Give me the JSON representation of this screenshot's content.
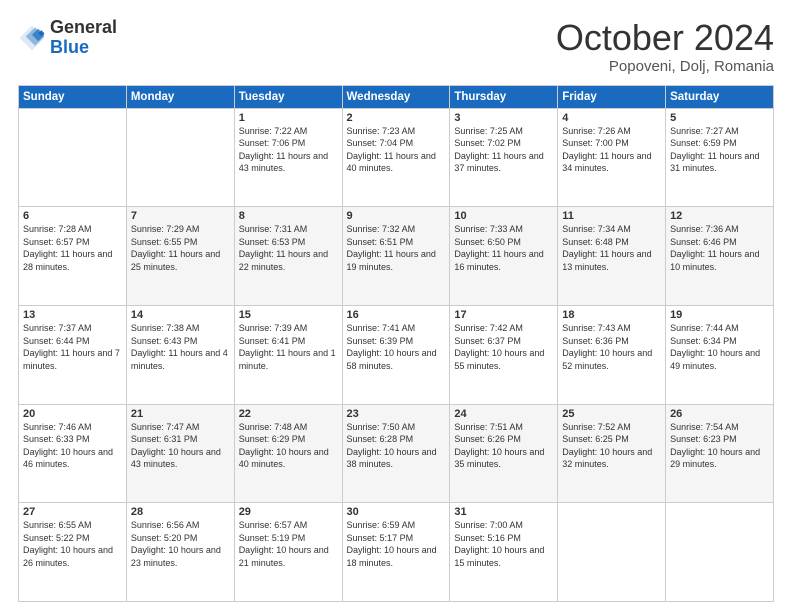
{
  "header": {
    "logo_general": "General",
    "logo_blue": "Blue",
    "month_title": "October 2024",
    "location": "Popoveni, Dolj, Romania"
  },
  "days_of_week": [
    "Sunday",
    "Monday",
    "Tuesday",
    "Wednesday",
    "Thursday",
    "Friday",
    "Saturday"
  ],
  "weeks": [
    [
      {
        "day": "",
        "info": ""
      },
      {
        "day": "",
        "info": ""
      },
      {
        "day": "1",
        "info": "Sunrise: 7:22 AM\nSunset: 7:06 PM\nDaylight: 11 hours and 43 minutes."
      },
      {
        "day": "2",
        "info": "Sunrise: 7:23 AM\nSunset: 7:04 PM\nDaylight: 11 hours and 40 minutes."
      },
      {
        "day": "3",
        "info": "Sunrise: 7:25 AM\nSunset: 7:02 PM\nDaylight: 11 hours and 37 minutes."
      },
      {
        "day": "4",
        "info": "Sunrise: 7:26 AM\nSunset: 7:00 PM\nDaylight: 11 hours and 34 minutes."
      },
      {
        "day": "5",
        "info": "Sunrise: 7:27 AM\nSunset: 6:59 PM\nDaylight: 11 hours and 31 minutes."
      }
    ],
    [
      {
        "day": "6",
        "info": "Sunrise: 7:28 AM\nSunset: 6:57 PM\nDaylight: 11 hours and 28 minutes."
      },
      {
        "day": "7",
        "info": "Sunrise: 7:29 AM\nSunset: 6:55 PM\nDaylight: 11 hours and 25 minutes."
      },
      {
        "day": "8",
        "info": "Sunrise: 7:31 AM\nSunset: 6:53 PM\nDaylight: 11 hours and 22 minutes."
      },
      {
        "day": "9",
        "info": "Sunrise: 7:32 AM\nSunset: 6:51 PM\nDaylight: 11 hours and 19 minutes."
      },
      {
        "day": "10",
        "info": "Sunrise: 7:33 AM\nSunset: 6:50 PM\nDaylight: 11 hours and 16 minutes."
      },
      {
        "day": "11",
        "info": "Sunrise: 7:34 AM\nSunset: 6:48 PM\nDaylight: 11 hours and 13 minutes."
      },
      {
        "day": "12",
        "info": "Sunrise: 7:36 AM\nSunset: 6:46 PM\nDaylight: 11 hours and 10 minutes."
      }
    ],
    [
      {
        "day": "13",
        "info": "Sunrise: 7:37 AM\nSunset: 6:44 PM\nDaylight: 11 hours and 7 minutes."
      },
      {
        "day": "14",
        "info": "Sunrise: 7:38 AM\nSunset: 6:43 PM\nDaylight: 11 hours and 4 minutes."
      },
      {
        "day": "15",
        "info": "Sunrise: 7:39 AM\nSunset: 6:41 PM\nDaylight: 11 hours and 1 minute."
      },
      {
        "day": "16",
        "info": "Sunrise: 7:41 AM\nSunset: 6:39 PM\nDaylight: 10 hours and 58 minutes."
      },
      {
        "day": "17",
        "info": "Sunrise: 7:42 AM\nSunset: 6:37 PM\nDaylight: 10 hours and 55 minutes."
      },
      {
        "day": "18",
        "info": "Sunrise: 7:43 AM\nSunset: 6:36 PM\nDaylight: 10 hours and 52 minutes."
      },
      {
        "day": "19",
        "info": "Sunrise: 7:44 AM\nSunset: 6:34 PM\nDaylight: 10 hours and 49 minutes."
      }
    ],
    [
      {
        "day": "20",
        "info": "Sunrise: 7:46 AM\nSunset: 6:33 PM\nDaylight: 10 hours and 46 minutes."
      },
      {
        "day": "21",
        "info": "Sunrise: 7:47 AM\nSunset: 6:31 PM\nDaylight: 10 hours and 43 minutes."
      },
      {
        "day": "22",
        "info": "Sunrise: 7:48 AM\nSunset: 6:29 PM\nDaylight: 10 hours and 40 minutes."
      },
      {
        "day": "23",
        "info": "Sunrise: 7:50 AM\nSunset: 6:28 PM\nDaylight: 10 hours and 38 minutes."
      },
      {
        "day": "24",
        "info": "Sunrise: 7:51 AM\nSunset: 6:26 PM\nDaylight: 10 hours and 35 minutes."
      },
      {
        "day": "25",
        "info": "Sunrise: 7:52 AM\nSunset: 6:25 PM\nDaylight: 10 hours and 32 minutes."
      },
      {
        "day": "26",
        "info": "Sunrise: 7:54 AM\nSunset: 6:23 PM\nDaylight: 10 hours and 29 minutes."
      }
    ],
    [
      {
        "day": "27",
        "info": "Sunrise: 6:55 AM\nSunset: 5:22 PM\nDaylight: 10 hours and 26 minutes."
      },
      {
        "day": "28",
        "info": "Sunrise: 6:56 AM\nSunset: 5:20 PM\nDaylight: 10 hours and 23 minutes."
      },
      {
        "day": "29",
        "info": "Sunrise: 6:57 AM\nSunset: 5:19 PM\nDaylight: 10 hours and 21 minutes."
      },
      {
        "day": "30",
        "info": "Sunrise: 6:59 AM\nSunset: 5:17 PM\nDaylight: 10 hours and 18 minutes."
      },
      {
        "day": "31",
        "info": "Sunrise: 7:00 AM\nSunset: 5:16 PM\nDaylight: 10 hours and 15 minutes."
      },
      {
        "day": "",
        "info": ""
      },
      {
        "day": "",
        "info": ""
      }
    ]
  ]
}
